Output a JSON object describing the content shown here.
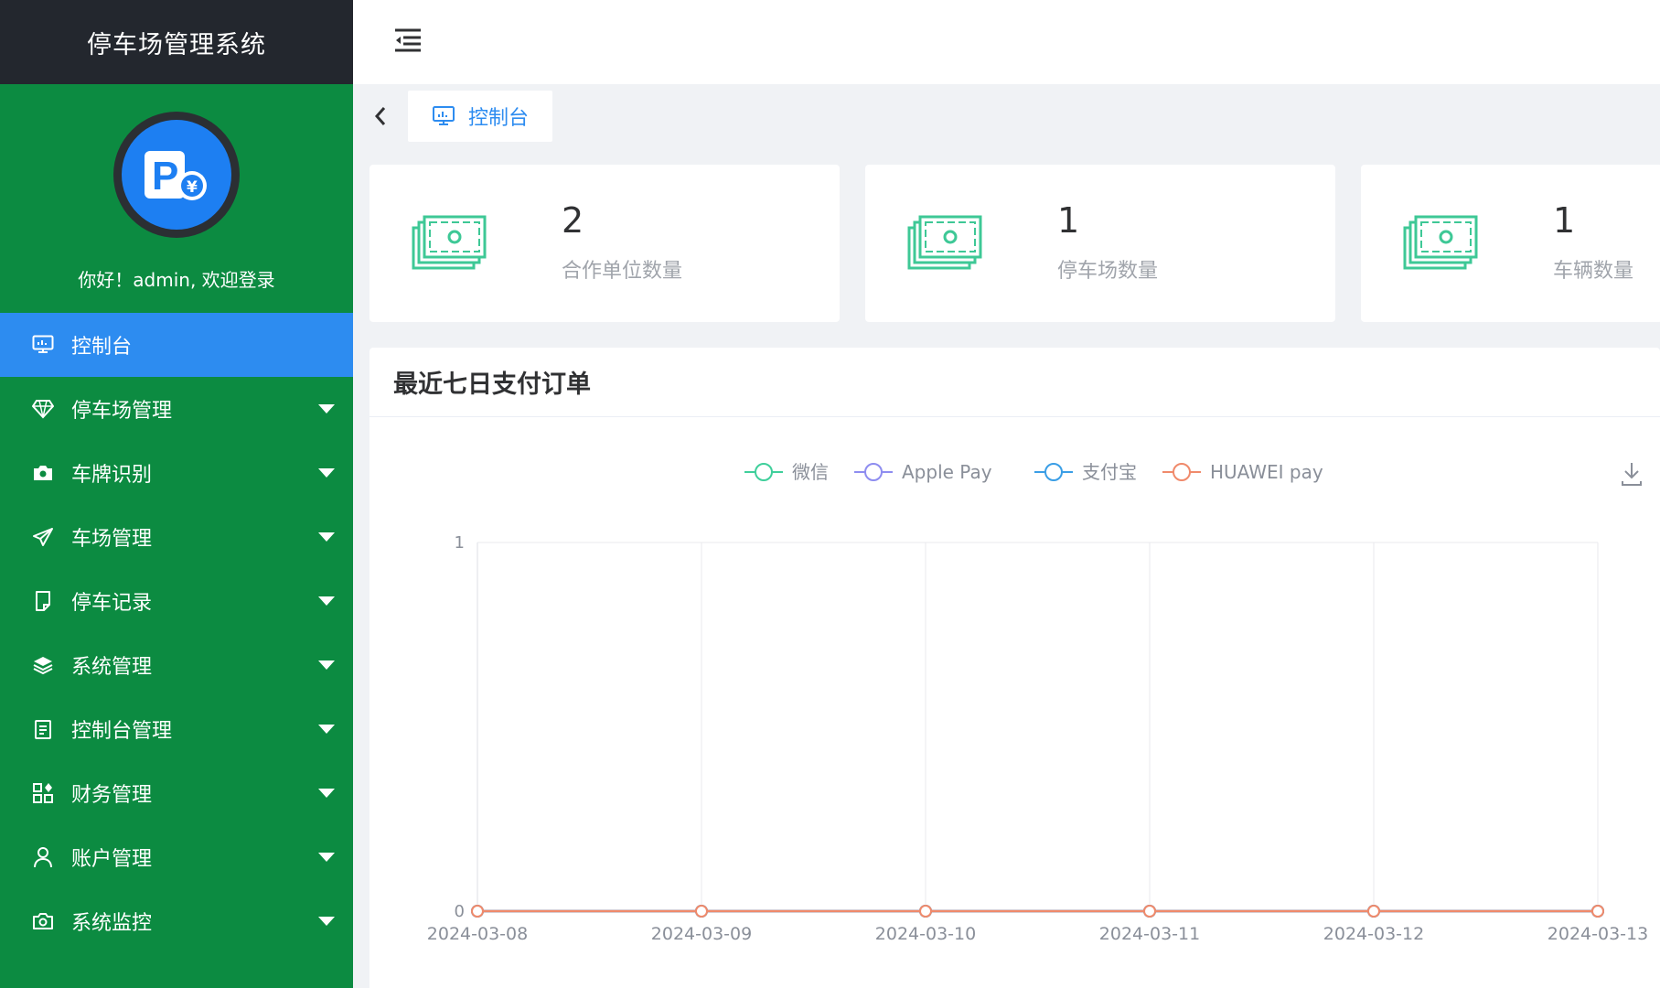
{
  "app": {
    "title": "停车场管理系统"
  },
  "sidebar": {
    "welcome": "你好！admin, 欢迎登录",
    "items": [
      {
        "label": "控制台",
        "icon": "monitor-icon",
        "active": true
      },
      {
        "label": "停车场管理",
        "icon": "diamond-icon"
      },
      {
        "label": "车牌识别",
        "icon": "camera-icon"
      },
      {
        "label": "车场管理",
        "icon": "send-icon"
      },
      {
        "label": "停车记录",
        "icon": "document-icon"
      },
      {
        "label": "系统管理",
        "icon": "layers-icon"
      },
      {
        "label": "控制台管理",
        "icon": "clipboard-icon"
      },
      {
        "label": "财务管理",
        "icon": "grid-icon"
      },
      {
        "label": "账户管理",
        "icon": "user-icon"
      },
      {
        "label": "系统监控",
        "icon": "camera-outline-icon"
      }
    ]
  },
  "tabs": {
    "current": "控制台"
  },
  "stats": [
    {
      "value": "2",
      "label": "合作单位数量"
    },
    {
      "value": "1",
      "label": "停车场数量"
    },
    {
      "value": "1",
      "label": "车辆数量"
    }
  ],
  "chart": {
    "title": "最近七日支付订单"
  },
  "chart_data": {
    "type": "line",
    "x": [
      "2024-03-08",
      "2024-03-09",
      "2024-03-10",
      "2024-03-11",
      "2024-03-12",
      "2024-03-13"
    ],
    "series": [
      {
        "name": "微信",
        "color": "#3fcf9b",
        "values": [
          0,
          0,
          0,
          0,
          0,
          0
        ]
      },
      {
        "name": "Apple Pay",
        "color": "#8e8df0",
        "values": [
          0,
          0,
          0,
          0,
          0,
          0
        ]
      },
      {
        "name": "支付宝",
        "color": "#3a9ee6",
        "values": [
          0,
          0,
          0,
          0,
          0,
          0
        ]
      },
      {
        "name": "HUAWEI pay",
        "color": "#f08a6b",
        "values": [
          0,
          0,
          0,
          0,
          0,
          0
        ]
      }
    ],
    "yticks": [
      "0",
      "1"
    ],
    "ylim": [
      0,
      1
    ],
    "legend": "top-center",
    "grid": true
  }
}
